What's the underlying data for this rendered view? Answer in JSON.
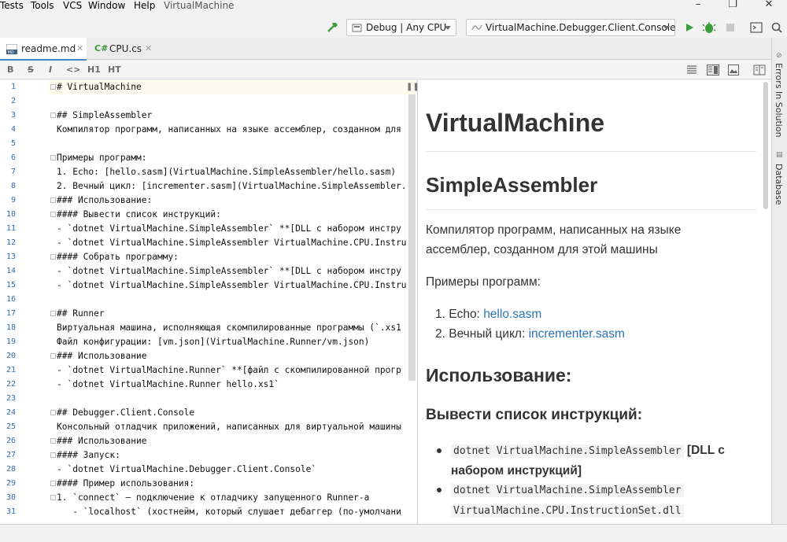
{
  "menu": {
    "items": [
      "Tests",
      "Tools",
      "VCS",
      "Window",
      "Help"
    ],
    "project": "VirtualMachine"
  },
  "toolbar": {
    "configuration": "Debug | Any CPU",
    "startup_project": "VirtualMachine.Debugger.Client.Console"
  },
  "tabs": [
    {
      "label": "readme.md",
      "active": true
    },
    {
      "label": "CPU.cs",
      "active": false
    }
  ],
  "md_toolbar": {
    "bold": "B",
    "strike": "S",
    "italic": "I",
    "code": "<>",
    "h1": "H1",
    "ht": "HT"
  },
  "right_strip": {
    "errors": "Errors In Solution",
    "database": "Database"
  },
  "editor": {
    "lines": [
      {
        "n": "1",
        "t": "# VirtualMachine"
      },
      {
        "n": "2",
        "t": ""
      },
      {
        "n": "3",
        "t": "## SimpleAssembler"
      },
      {
        "n": "4",
        "t": "Компилятор программ, написанных на языке ассемблер, созданном для"
      },
      {
        "n": "5",
        "t": ""
      },
      {
        "n": "6",
        "t": "Примеры программ:"
      },
      {
        "n": "7",
        "t": "1. Echo: [hello.sasm](VirtualMachine.SimpleAssembler/hello.sasm)"
      },
      {
        "n": "8",
        "t": "2. Вечный цикл: [incrementer.sasm](VirtualMachine.SimpleAssembler."
      },
      {
        "n": "9",
        "t": "### Использование:"
      },
      {
        "n": "10",
        "t": "#### Вывести список инструкций:"
      },
      {
        "n": "11",
        "t": "- `dotnet VirtualMachine.SimpleAssembler` **[DLL с набором инстру"
      },
      {
        "n": "12",
        "t": "- `dotnet VirtualMachine.SimpleAssembler VirtualMachine.CPU.Instru"
      },
      {
        "n": "13",
        "t": "#### Собрать программу:"
      },
      {
        "n": "14",
        "t": "- `dotnet VirtualMachine.SimpleAssembler` **[DLL с набором инстру"
      },
      {
        "n": "15",
        "t": "- `dotnet VirtualMachine.SimpleAssembler VirtualMachine.CPU.Instru"
      },
      {
        "n": "16",
        "t": ""
      },
      {
        "n": "17",
        "t": "## Runner"
      },
      {
        "n": "18",
        "t": "Виртуальная машина, исполняющая скомпилированные программы (`.xs1"
      },
      {
        "n": "19",
        "t": "Файл конфигурации: [vm.json](VirtualMachine.Runner/vm.json)"
      },
      {
        "n": "20",
        "t": "### Использование"
      },
      {
        "n": "21",
        "t": "- `dotnet VirtualMachine.Runner` **[файл с скомпилированной прогр"
      },
      {
        "n": "22",
        "t": "- `dotnet VirtualMachine.Runner hello.xs1`"
      },
      {
        "n": "23",
        "t": ""
      },
      {
        "n": "24",
        "t": "## Debugger.Client.Console"
      },
      {
        "n": "25",
        "t": "Консольный отладчик приложений, написанных для виртуальной машины"
      },
      {
        "n": "26",
        "t": "### Использование"
      },
      {
        "n": "27",
        "t": "#### Запуск:"
      },
      {
        "n": "28",
        "t": "- `dotnet VirtualMachine.Debugger.Client.Console`"
      },
      {
        "n": "29",
        "t": "#### Пример использования:"
      },
      {
        "n": "30",
        "t": "1. `connect` — подключение к отладчику запущенного Runner-а"
      },
      {
        "n": "31",
        "t": "   - `localhost` (хостнейм, который слушает дебаггер (по-умолчани"
      }
    ]
  },
  "preview": {
    "h1": "VirtualMachine",
    "h2": "SimpleAssembler",
    "intro": "Компилятор программ, написанных на языке ассемблер, созданном для этой машины",
    "examples_label": "Примеры программ:",
    "example1_prefix": "1.  Echo: ",
    "example1_link": "hello.sasm",
    "example2_prefix": "2.  Вечный цикл: ",
    "example2_link": "incrementer.sasm",
    "h3": "Использование:",
    "h4": "Вывести список инструкций:",
    "b1_code": "dotnet VirtualMachine.SimpleAssembler",
    "b1_strong_a": "[DLL с",
    "b1_strong_b": "набором инструкций]",
    "b2_code_a": "dotnet VirtualMachine.SimpleAssembler",
    "b2_code_b": "VirtualMachine.CPU.InstructionSet.dll"
  },
  "colors": {
    "accent": "#4a88c7",
    "link": "#2a73b5",
    "line_numbers": "#2b6fb3",
    "run": "#3a9c3a"
  }
}
